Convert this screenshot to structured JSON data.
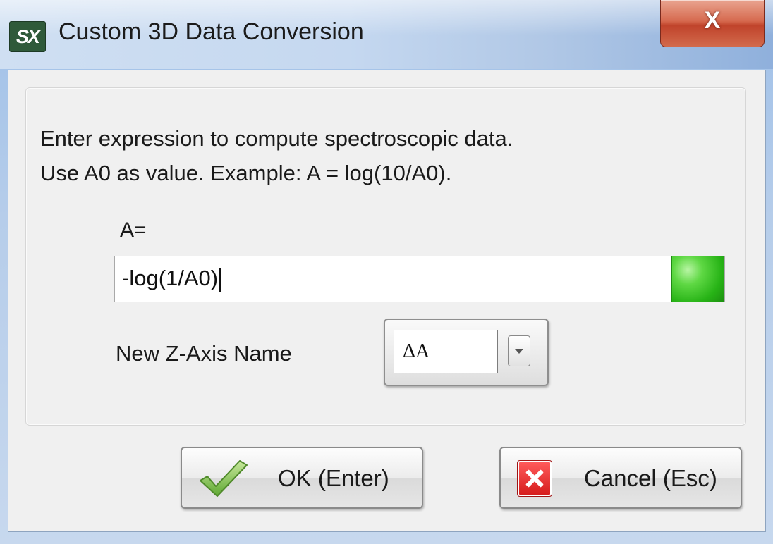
{
  "window": {
    "title": "Custom 3D Data Conversion",
    "app_icon_text": "SX",
    "close_glyph": "X"
  },
  "instructions": {
    "line1": "Enter expression to compute spectroscopic data.",
    "line2": "Use A0 as value. Example: A = log(10/A0)."
  },
  "expression": {
    "label": "A=",
    "value": "-log(1/A0)",
    "status_color": "#3cc22a"
  },
  "z_axis": {
    "label": "New Z-Axis Name",
    "selected": "ΔA"
  },
  "buttons": {
    "ok_label": "OK (Enter)",
    "cancel_label": "Cancel (Esc)"
  },
  "icons": {
    "ok": "checkmark-icon",
    "cancel": "red-x-icon"
  }
}
